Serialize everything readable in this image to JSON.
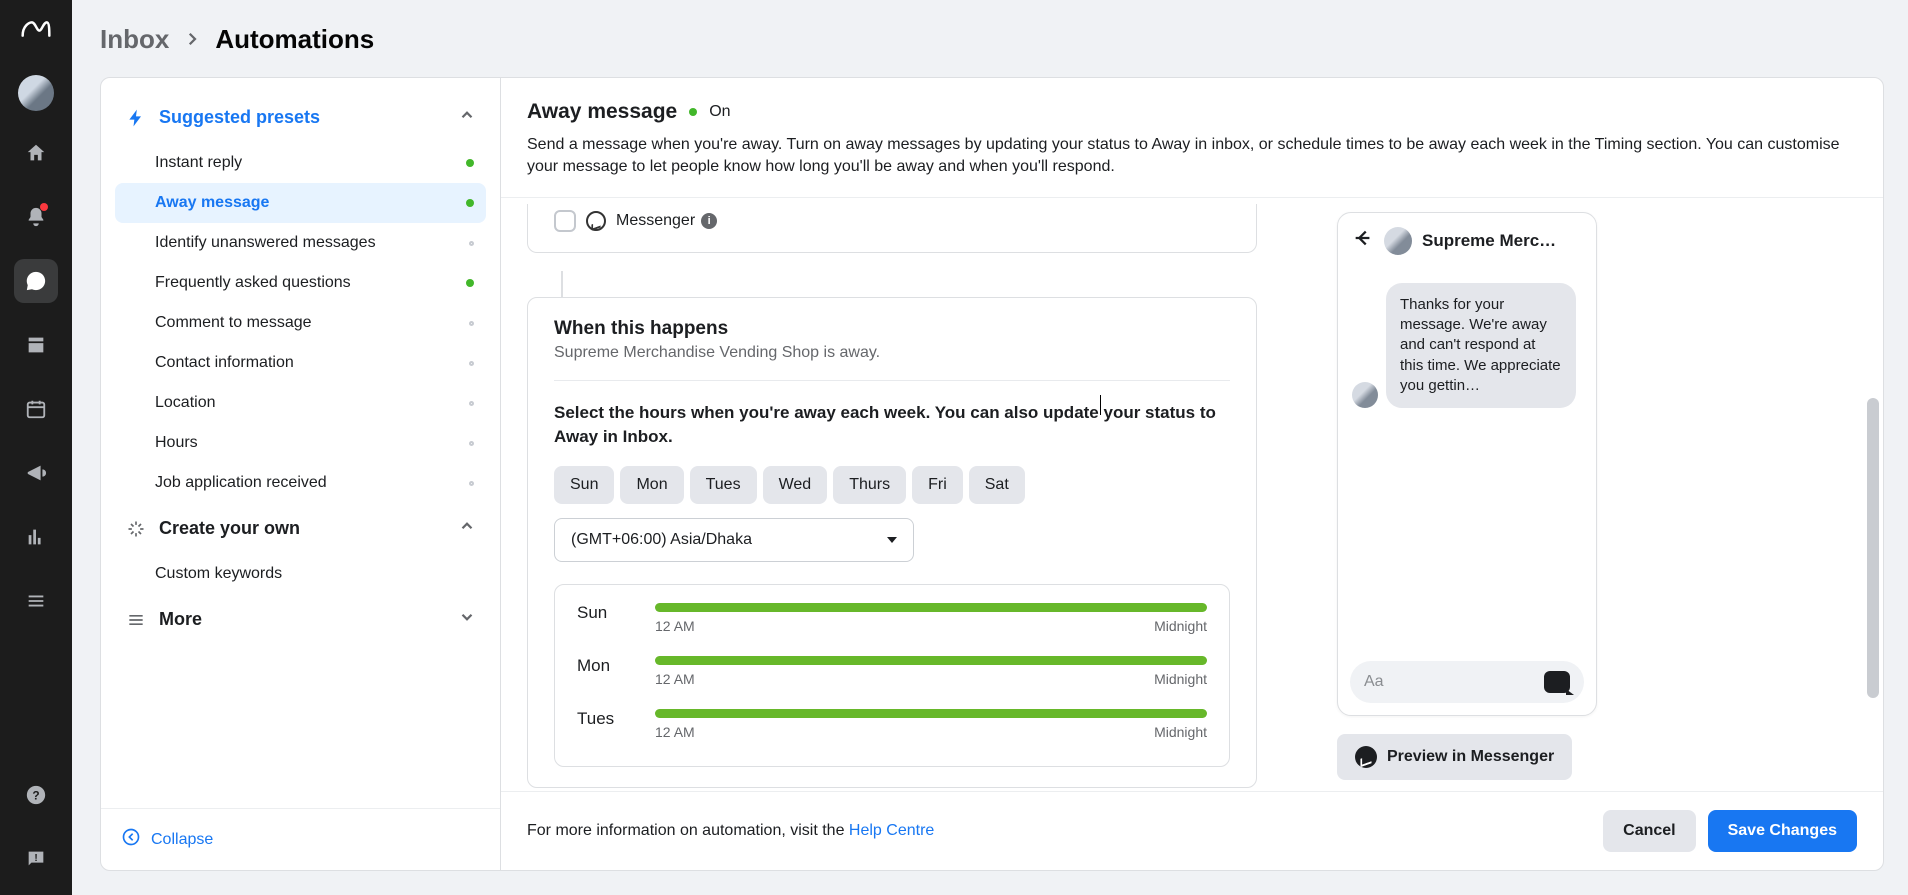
{
  "breadcrumb": {
    "inbox": "Inbox",
    "automations": "Automations"
  },
  "sidebar": {
    "suggested_title": "Suggested presets",
    "items": [
      {
        "label": "Instant reply",
        "status": "green"
      },
      {
        "label": "Away message",
        "status": "green"
      },
      {
        "label": "Identify unanswered messages",
        "status": "gray"
      },
      {
        "label": "Frequently asked questions",
        "status": "green"
      },
      {
        "label": "Comment to message",
        "status": "gray"
      },
      {
        "label": "Contact information",
        "status": "gray"
      },
      {
        "label": "Location",
        "status": "gray"
      },
      {
        "label": "Hours",
        "status": "gray"
      },
      {
        "label": "Job application received",
        "status": "gray"
      }
    ],
    "create_own": "Create your own",
    "custom_keywords": "Custom keywords",
    "more": "More",
    "collapse": "Collapse"
  },
  "header": {
    "title": "Away message",
    "status": "On",
    "description": "Send a message when you're away. Turn on away messages by updating your status to Away in inbox, or schedule times to be away each week in the Timing section. You can customise your message to let people know how long you'll be away and when you'll respond."
  },
  "channels": {
    "messenger": "Messenger"
  },
  "when": {
    "title": "When this happens",
    "subtitle": "Supreme Merchandise Vending Shop is away.",
    "instruction": "Select the hours when you're away each week. You can also update your status to Away in Inbox.",
    "days": [
      "Sun",
      "Mon",
      "Tues",
      "Wed",
      "Thurs",
      "Fri",
      "Sat"
    ],
    "timezone": "(GMT+06:00) Asia/Dhaka",
    "schedule": [
      {
        "day": "Sun",
        "start": "12 AM",
        "end": "Midnight"
      },
      {
        "day": "Mon",
        "start": "12 AM",
        "end": "Midnight"
      },
      {
        "day": "Tues",
        "start": "12 AM",
        "end": "Midnight"
      }
    ]
  },
  "preview": {
    "name": "Supreme Merc…",
    "message": "Thanks for your message. We're away and can't respond at this time. We appreciate you gettin…",
    "composer_placeholder": "Aa",
    "preview_button": "Preview in Messenger"
  },
  "footer": {
    "info_prefix": "For more information on automation, visit the ",
    "help_link": "Help Centre",
    "cancel": "Cancel",
    "save": "Save Changes"
  }
}
